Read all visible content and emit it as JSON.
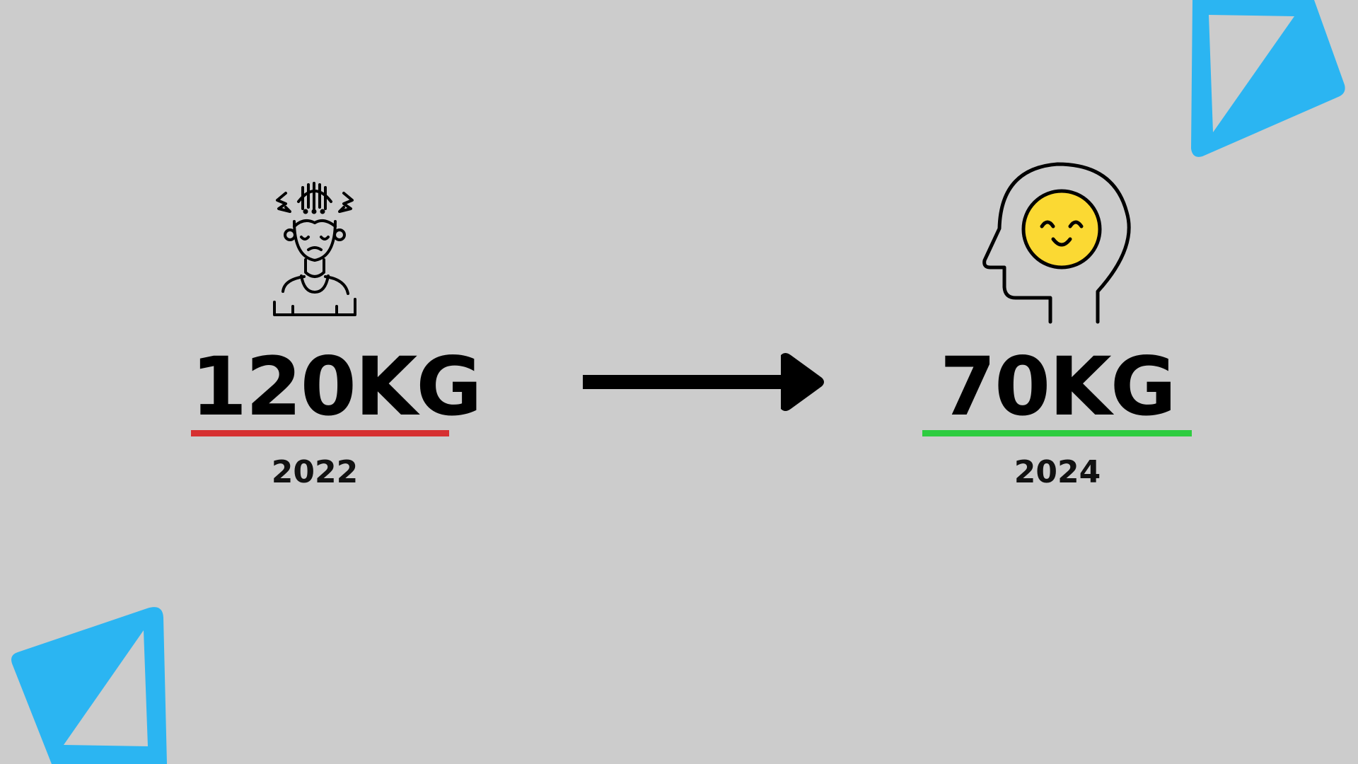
{
  "colors": {
    "background": "#cccccc",
    "accent_blue": "#2bb5f2",
    "before_red": "#d63031",
    "after_green": "#2ecc40",
    "smile_yellow": "#fbd933",
    "ink": "#000000"
  },
  "before": {
    "weight": "120KG",
    "year": "2022",
    "icon": "stressed-person-icon"
  },
  "after": {
    "weight": "70KG",
    "year": "2024",
    "icon": "happy-mind-head-icon"
  },
  "transition": {
    "icon": "right-arrow-icon"
  }
}
